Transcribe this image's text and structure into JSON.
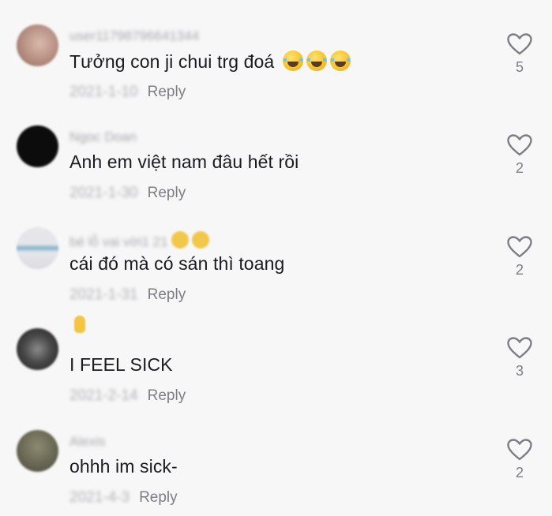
{
  "comments": [
    {
      "username": "user11798796641344",
      "text": "Tưởng con ji chui trg đoá",
      "date": "2021-1-10",
      "reply_label": "Reply",
      "likes": "5",
      "avatar_color": "#c9a79a",
      "emoji_count": 3
    },
    {
      "username": "Ngoc Doan",
      "text": "Anh em việt nam đâu hết rồi",
      "date": "2021-1-30",
      "reply_label": "Reply",
      "likes": "2",
      "avatar_color": "#0c0c0c"
    },
    {
      "username": "bé lỗ vai vời1 21",
      "text": "cái đó mà có sán thì toang",
      "date": "2021-1-31",
      "reply_label": "Reply",
      "likes": "2",
      "avatar_color": "#dfe3ea"
    },
    {
      "username": "",
      "text": "I FEEL SICK",
      "date": "2021-2-14",
      "reply_label": "Reply",
      "likes": "3",
      "avatar_color": "#3a3a3a"
    },
    {
      "username": "Alexis",
      "text": "ohhh im sick-",
      "date": "2021-4-3",
      "reply_label": "Reply",
      "likes": "2",
      "avatar_color": "#6b6a55"
    }
  ],
  "icons": {
    "like": "heart-outline-icon"
  },
  "colors": {
    "reply": "#7d7e85",
    "heart_stroke": "#7d7e85",
    "background": "#f7f7f7"
  }
}
